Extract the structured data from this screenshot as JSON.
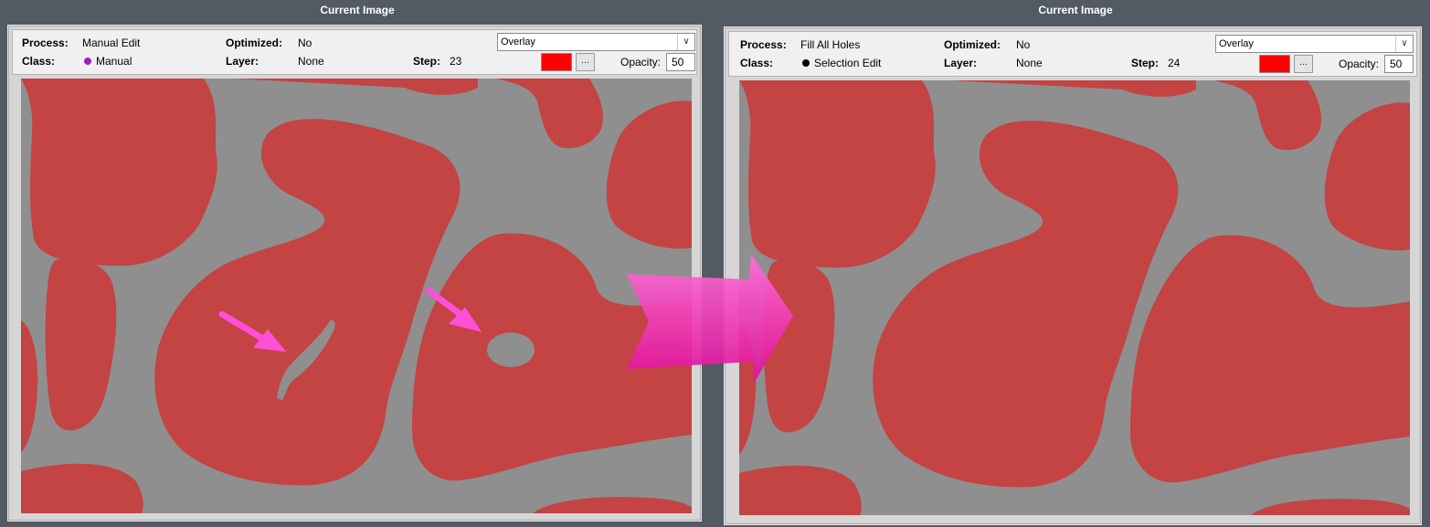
{
  "left_panel": {
    "title": "Current Image",
    "process_label": "Process:",
    "process_value": "Manual Edit",
    "class_label": "Class:",
    "class_value": "Manual",
    "class_dot_color": "#9b1fc4",
    "optimized_label": "Optimized:",
    "optimized_value": "No",
    "layer_label": "Layer:",
    "layer_value": "None",
    "step_label": "Step:",
    "step_value": "23",
    "display_mode": "Overlay",
    "overlay_color": "#ff0000",
    "color_picker_label": "...",
    "opacity_label": "Opacity:",
    "opacity_value": "50"
  },
  "right_panel": {
    "title": "Current Image",
    "process_label": "Process:",
    "process_value": "Fill All Holes",
    "class_label": "Class:",
    "class_value": "Selection Edit",
    "class_dot_color": "#000000",
    "optimized_label": "Optimized:",
    "optimized_value": "No",
    "layer_label": "Layer:",
    "layer_value": "None",
    "step_label": "Step:",
    "step_value": "24",
    "display_mode": "Overlay",
    "overlay_color": "#ff0000",
    "color_picker_label": "...",
    "opacity_label": "Opacity:",
    "opacity_value": "50"
  },
  "colors": {
    "background": "#525a63",
    "segmentation_fill": "#c44343",
    "image_gray": "#8f8f8f",
    "annotation_arrow": "#ff4fd8",
    "transition_arrow": "#f01ba6"
  },
  "icons": {
    "dropdown": "chevron-down-icon",
    "annotation_arrows": "arrow-pointer-icon",
    "transition": "right-arrow-icon"
  }
}
